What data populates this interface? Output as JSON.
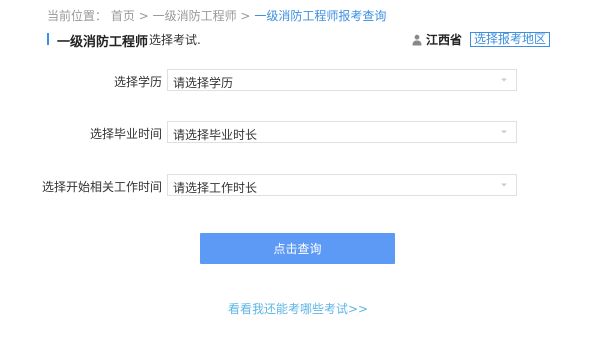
{
  "breadcrumb": {
    "prefix": "当前位置：",
    "items": [
      "首页",
      "一级消防工程师",
      "一级消防工程师报考查询"
    ],
    "separator": ">"
  },
  "header": {
    "title": "一级消防工程师",
    "subtitle": "选择考试.",
    "province": "江西省",
    "region_button": "选择报考地区"
  },
  "form": {
    "fields": [
      {
        "label": "选择学历",
        "value": "请选择学历"
      },
      {
        "label": "选择毕业时间",
        "value": "请选择毕业时长"
      },
      {
        "label": "选择开始相关工作时间",
        "value": "请选择工作时长"
      }
    ]
  },
  "actions": {
    "query_button": "点击查询",
    "more_link": "看看我还能考哪些考试>>"
  },
  "colors": {
    "accent": "#3d8fe0",
    "button": "#5d9af5",
    "link": "#5fb6e6"
  },
  "icons": {
    "user": "user-icon",
    "dropdown": "chevron-down-icon"
  }
}
